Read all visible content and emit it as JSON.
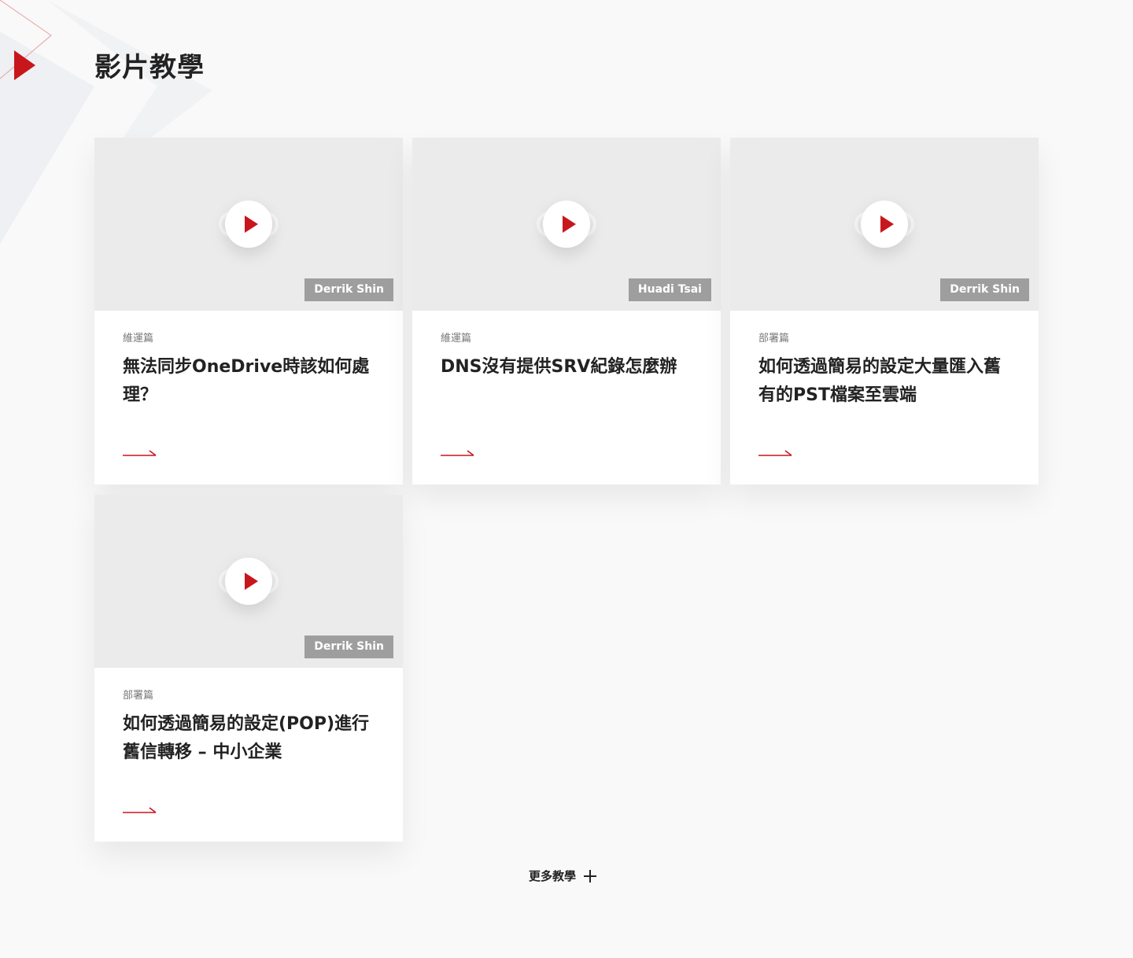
{
  "section": {
    "title": "影片教學",
    "accent_color": "#c8161d",
    "marker_icon": "play-triangle-icon"
  },
  "videos": [
    {
      "author": "Derrik Shin",
      "category": "維運篇",
      "title": "無法同步OneDrive時該如何處理？",
      "icon": "play-icon"
    },
    {
      "author": "Huadi Tsai",
      "category": "維運篇",
      "title": "DNS沒有提供SRV紀錄怎麼辦",
      "icon": "play-icon"
    },
    {
      "author": "Derrik Shin",
      "category": "部署篇",
      "title": "如何透過簡易的設定大量匯入舊有的PST檔案至雲端",
      "icon": "play-icon"
    },
    {
      "author": "Derrik Shin",
      "category": "部署篇",
      "title": "如何透過簡易的設定(POP)進行舊信轉移 – 中小企業",
      "icon": "play-icon"
    }
  ],
  "more": {
    "label": "更多教學",
    "icon": "plus-icon"
  }
}
